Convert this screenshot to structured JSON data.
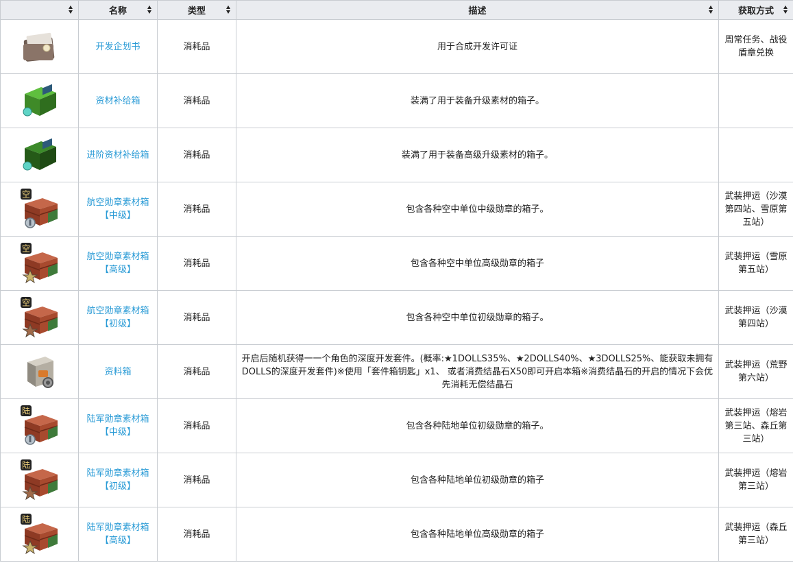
{
  "headers": [
    {
      "label": ""
    },
    {
      "label": "名称"
    },
    {
      "label": "类型"
    },
    {
      "label": "描述"
    },
    {
      "label": "获取方式"
    }
  ],
  "rows": [
    {
      "name": "开发企划书",
      "type": "消耗品",
      "desc": "用于合成开发许可证",
      "source": "周常任务、战役盾章兑换",
      "icon": "planning-book-icon"
    },
    {
      "name": "资材补给箱",
      "type": "消耗品",
      "desc": "装满了用于装备升级素材的箱子。",
      "source": "",
      "icon": "green-supply-crate-icon"
    },
    {
      "name": "进阶资材补给箱",
      "type": "消耗品",
      "desc": "装满了用于装备高级升级素材的箱子。",
      "source": "",
      "icon": "green-advanced-crate-icon"
    },
    {
      "name": "航空勋章素材箱【中级】",
      "type": "消耗品",
      "desc": "包含各种空中单位中级勋章的箱子。",
      "source": "武装押运（沙漠第四站、雪原第五站）",
      "icon": "air-medal-crate-mid-icon",
      "badge": "空",
      "medal": "silver"
    },
    {
      "name": "航空勋章素材箱【高级】",
      "type": "消耗品",
      "desc": "包含各种空中单位高级勋章的箱子",
      "source": "武装押运（雪原第五站）",
      "icon": "air-medal-crate-high-icon",
      "badge": "空",
      "medal": "gold"
    },
    {
      "name": "航空勋章素材箱【初级】",
      "type": "消耗品",
      "desc": "包含各种空中单位初级勋章的箱子。",
      "source": "武装押运（沙漠第四站）",
      "icon": "air-medal-crate-low-icon",
      "badge": "空",
      "medal": "bronze"
    },
    {
      "name": "资料箱",
      "type": "消耗品",
      "desc": "开启后随机获得一一个角色的深度开发套件。(概率:★1DOLLS35%、★2DOLLS40%、★3DOLLS25%、能获取未拥有DOLLS的深度开发套件)※使用「套件箱钥匙」x1、 或者消费结晶石X50即可开启本箱※消费结晶石的开启的情况下会优先消耗无偿结晶石",
      "source": "武装押运（荒野第六站）",
      "icon": "data-box-icon"
    },
    {
      "name": "陆军勋章素材箱【中级】",
      "type": "消耗品",
      "desc": "包含各种陆地单位初级勋章的箱子。",
      "source": "武装押运（熔岩第三站、森丘第三站）",
      "icon": "army-medal-crate-mid-icon",
      "badge": "陆",
      "medal": "silver"
    },
    {
      "name": "陆军勋章素材箱【初级】",
      "type": "消耗品",
      "desc": "包含各种陆地单位初级勋章的箱子",
      "source": "武装押运（熔岩第三站）",
      "icon": "army-medal-crate-low-icon",
      "badge": "陆",
      "medal": "bronze"
    },
    {
      "name": "陆军勋章素材箱【高级】",
      "type": "消耗品",
      "desc": "包含各种陆地单位高级勋章的箱子",
      "source": "武装押运（森丘第三站）",
      "icon": "army-medal-crate-high-icon",
      "badge": "陆",
      "medal": "gold"
    }
  ]
}
